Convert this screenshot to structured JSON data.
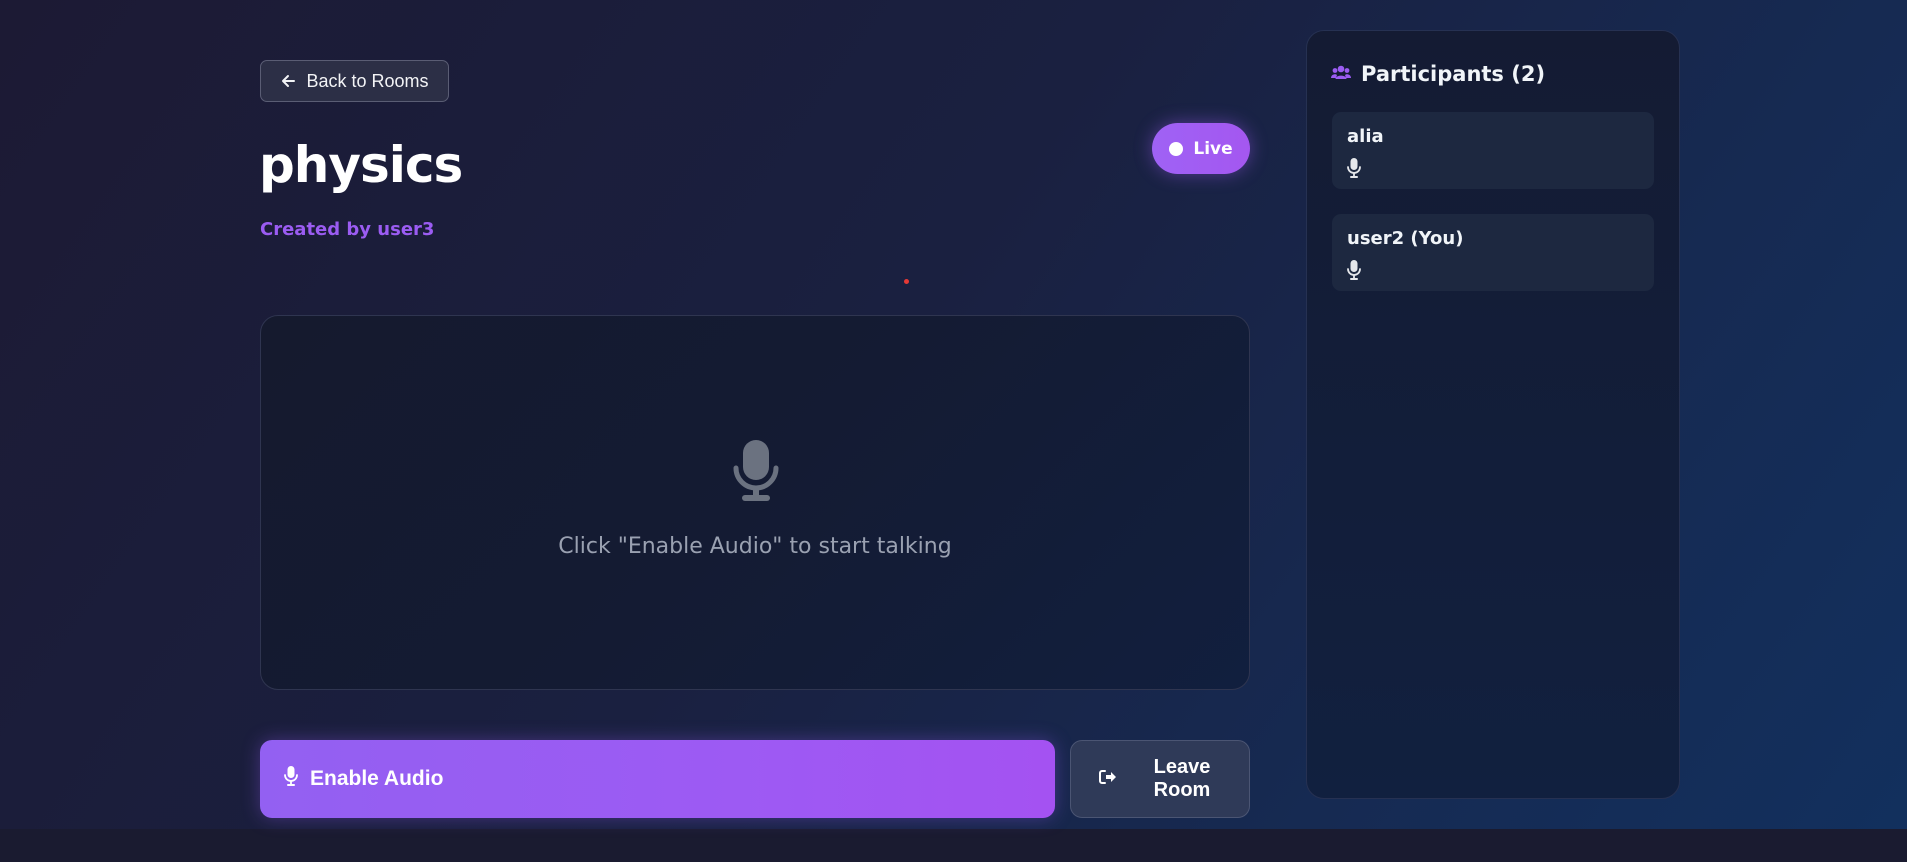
{
  "nav": {
    "back_label": "Back to Rooms",
    "back_icon": "arrow-left-icon"
  },
  "room": {
    "title": "physics",
    "created_by": "Created by user3"
  },
  "status": {
    "label": "Live",
    "color": "#a05af4"
  },
  "audio_panel": {
    "icon": "microphone-icon",
    "message": "Click \"Enable Audio\" to start talking"
  },
  "controls": {
    "enable_audio_label": "Enable Audio",
    "enable_audio_icon": "microphone-icon",
    "leave_room_label": "Leave Room",
    "leave_room_icon": "sign-out-icon"
  },
  "participants": {
    "title": "Participants (2)",
    "icon": "users-icon",
    "items": [
      {
        "name": "alia",
        "icon": "microphone-icon"
      },
      {
        "name": "user2 (You)",
        "icon": "microphone-icon"
      }
    ]
  },
  "colors": {
    "accent": "#9b5cf2",
    "background": "#1a2040",
    "panel": "#141b33"
  }
}
